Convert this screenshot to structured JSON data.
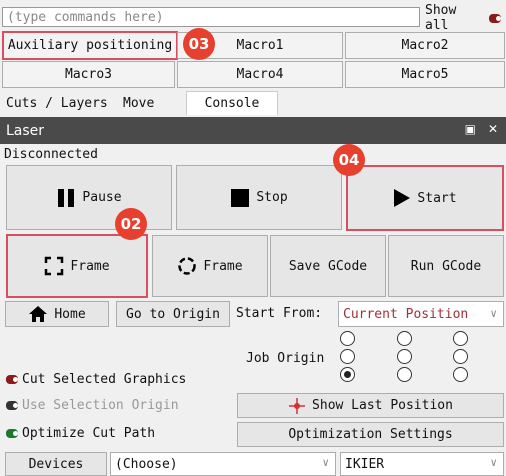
{
  "command": {
    "placeholder": "(type commands here)",
    "show_all_label": "Show all"
  },
  "macros": {
    "aux_positioning": "Auxiliary positioning",
    "macro1": "Macro1",
    "macro2": "Macro2",
    "macro3": "Macro3",
    "macro4": "Macro4",
    "macro5": "Macro5"
  },
  "tabs": [
    {
      "label": "Cuts / Layers"
    },
    {
      "label": "Move"
    },
    {
      "label": "Console"
    }
  ],
  "panel": {
    "title": "Laser",
    "status": "Disconnected"
  },
  "buttons": {
    "pause": "Pause",
    "stop": "Stop",
    "start": "Start",
    "frame1": "Frame",
    "frame2": "Frame",
    "save_gcode": "Save GCode",
    "run_gcode": "Run GCode",
    "home": "Home",
    "go_to_origin": "Go to Origin",
    "show_last_position": "Show Last Position",
    "optimization_settings": "Optimization Settings",
    "devices": "Devices"
  },
  "start_from": {
    "label": "Start From:",
    "value": "Current Position"
  },
  "job_origin": {
    "label": "Job Origin"
  },
  "options": {
    "cut_selected": "Cut Selected Graphics",
    "use_selection_origin": "Use Selection Origin",
    "optimize_cut_path": "Optimize Cut Path"
  },
  "device_select": {
    "value": "(Choose)"
  },
  "device_name": {
    "value": "IKIER"
  },
  "badges": {
    "b02": "02",
    "b03": "03",
    "b04": "04"
  },
  "colors": {
    "titlebar": "#4a4a4a",
    "highlight": "#d8505f",
    "badge": "#e8402f",
    "start_from_text": "#a0303a",
    "toggle_red": "#8b1a1a",
    "toggle_dark": "#333333",
    "toggle_green": "#1c7a2c"
  }
}
